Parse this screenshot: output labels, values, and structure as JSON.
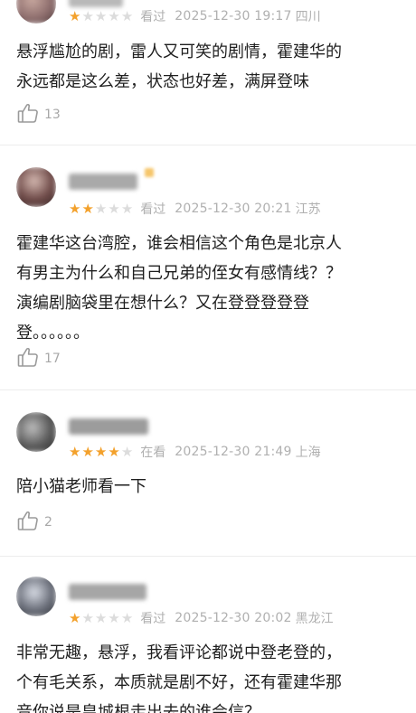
{
  "reviews": [
    {
      "rating": 1,
      "status": "看过",
      "time": "2025-12-30 19:17",
      "location": "四川",
      "lines": [
        "悬浮尴尬的剧，雷人又可笑的剧情，霍建华的",
        "永远都是这么差，状态也好差，满屏登味"
      ],
      "likes": "13",
      "avatar_color": "#8a6a6a"
    },
    {
      "rating": 2,
      "status": "看过",
      "time": "2025-12-30 20:21",
      "location": "江苏",
      "lines": [
        "霍建华这台湾腔，谁会相信这个角色是北京人",
        "有男主为什么和自己兄弟的侄女有感情线？？",
        "演编剧脑袋里在想什么？又在登登登登登",
        "登。。。。。。"
      ],
      "likes": "17",
      "avatar_color": "#6e4a48"
    },
    {
      "rating": 4,
      "status": "在看",
      "time": "2025-12-30 21:49",
      "location": "上海",
      "lines": [
        "陪小猫老师看一下"
      ],
      "likes": "2",
      "avatar_color": "#5a5a5a"
    },
    {
      "rating": 1,
      "status": "看过",
      "time": "2025-12-30 20:02",
      "location": "黑龙江",
      "lines": [
        "非常无趣，悬浮，我看评论都说中登老登的，",
        "个有毛关系，本质就是剧不好，还有霍建华那",
        "音你说是皇城根走出去的谁会信？"
      ],
      "likes": "",
      "avatar_color": "#6b6f7a"
    }
  ],
  "colors": {
    "star_on": "#f3a12c",
    "star_off": "#dcdcdc",
    "meta": "#b0b0b0",
    "text": "#1f1f1f",
    "divider": "#ececec"
  },
  "icons": {
    "rating_star": "star-icon",
    "like": "thumbs-up-icon"
  }
}
